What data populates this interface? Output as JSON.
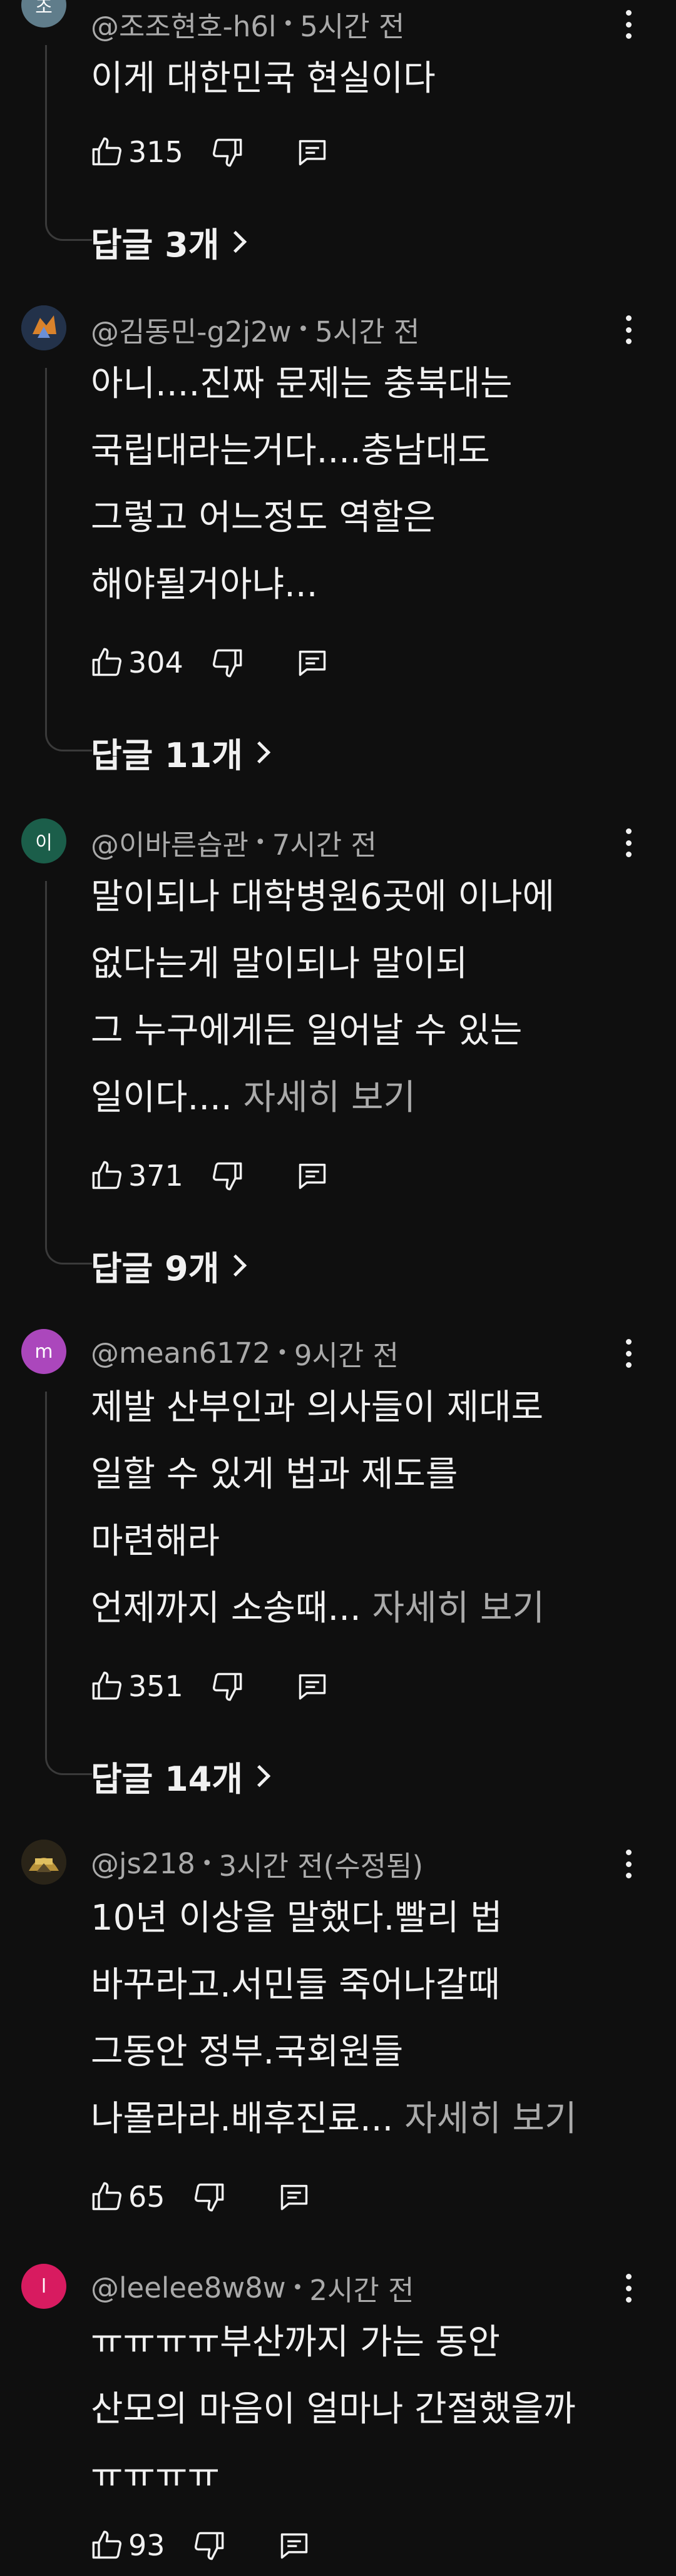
{
  "comments": [
    {
      "avatar_text": "조",
      "avatar_color": "#607d8b",
      "author": "@조조현호-h6l",
      "time": "5시간 전",
      "lines": [
        "이게 대한민국 현실이다"
      ],
      "more_label": "",
      "likes": "315",
      "replies_label": "답글 3개"
    },
    {
      "avatar_text": "",
      "avatar_color": "#23324a",
      "author": "@김동민-g2j2w",
      "time": "5시간 전",
      "lines": [
        "아니....진짜 문제는 충북대는",
        "국립대라는거다....충남대도",
        "그렇고 어느정도 역할은",
        "해야될거아냐..."
      ],
      "more_label": "",
      "likes": "304",
      "replies_label": "답글 11개"
    },
    {
      "avatar_text": "이",
      "avatar_color": "#1b5e4a",
      "author": "@이바른습관",
      "time": "7시간 전",
      "lines": [
        "말이되나 대학병원6곳에 이나에",
        "없다는게 말이되나 말이되",
        "그 누구에게든 일어날 수 있는",
        "일이다...."
      ],
      "more_label": "자세히 보기",
      "likes": "371",
      "replies_label": "답글 9개"
    },
    {
      "avatar_text": "m",
      "avatar_color": "#ab47bc",
      "author": "@mean6172",
      "time": "9시간 전",
      "lines": [
        "제발 산부인과 의사들이 제대로",
        "일할 수 있게 법과 제도를",
        "마련해라",
        "언제까지 소송때..."
      ],
      "more_label": "자세히 보기",
      "likes": "351",
      "replies_label": "답글 14개"
    },
    {
      "avatar_text": "",
      "avatar_color": "#2a2418",
      "author": "@js218",
      "time": "3시간 전(수정됨)",
      "lines": [
        "10년 이상을 말했다.빨리 법",
        "바꾸라고.서민들 죽어나갈때",
        "그동안 정부.국회원들",
        "나몰라라.배후진료..."
      ],
      "more_label": "자세히 보기",
      "likes": "65",
      "replies_label": ""
    },
    {
      "avatar_text": "l",
      "avatar_color": "#d81b60",
      "author": "@leelee8w8w",
      "time": "2시간 전",
      "lines": [
        "ㅠㅠㅠㅠ부산까지 가는 동안",
        "산모의 마음이 얼마나 간절했을까",
        "ㅠㅠㅠㅠ"
      ],
      "more_label": "",
      "likes": "93",
      "replies_label": ""
    }
  ]
}
